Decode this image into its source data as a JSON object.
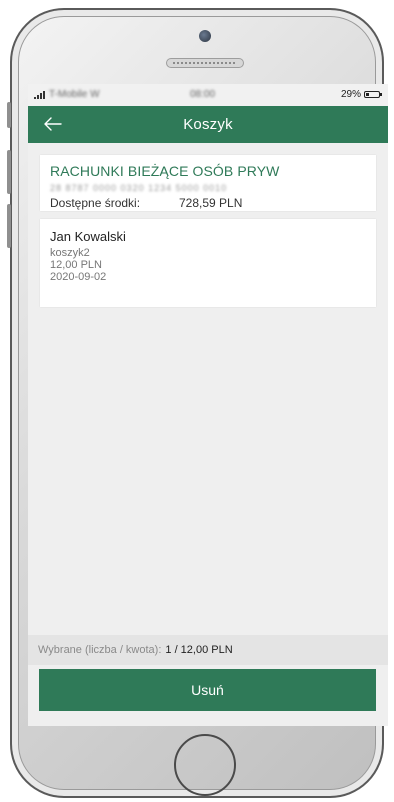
{
  "status_bar": {
    "carrier": "T-Mobile W",
    "time": "08:00",
    "battery_percent": "29%",
    "battery_level": 0.29
  },
  "header": {
    "title": "Koszyk",
    "back_icon": "arrow-left-icon"
  },
  "account": {
    "name": "RACHUNKI BIEŻĄCE OSÓB PRYW",
    "number": "28 8787 0000 0320 1234 5000 0010",
    "balance_label": "Dostępne środki:",
    "balance_value": "728,59 PLN"
  },
  "basket_items": [
    {
      "name": "Jan Kowalski",
      "title": "koszyk2",
      "amount": "12,00 PLN",
      "date": "2020-09-02"
    }
  ],
  "summary": {
    "label": "Wybrane (liczba / kwota):",
    "value": "1 / 12,00 PLN"
  },
  "actions": {
    "remove_label": "Usuń"
  },
  "colors": {
    "brand_green": "#2f7a58",
    "background": "#efefef"
  }
}
